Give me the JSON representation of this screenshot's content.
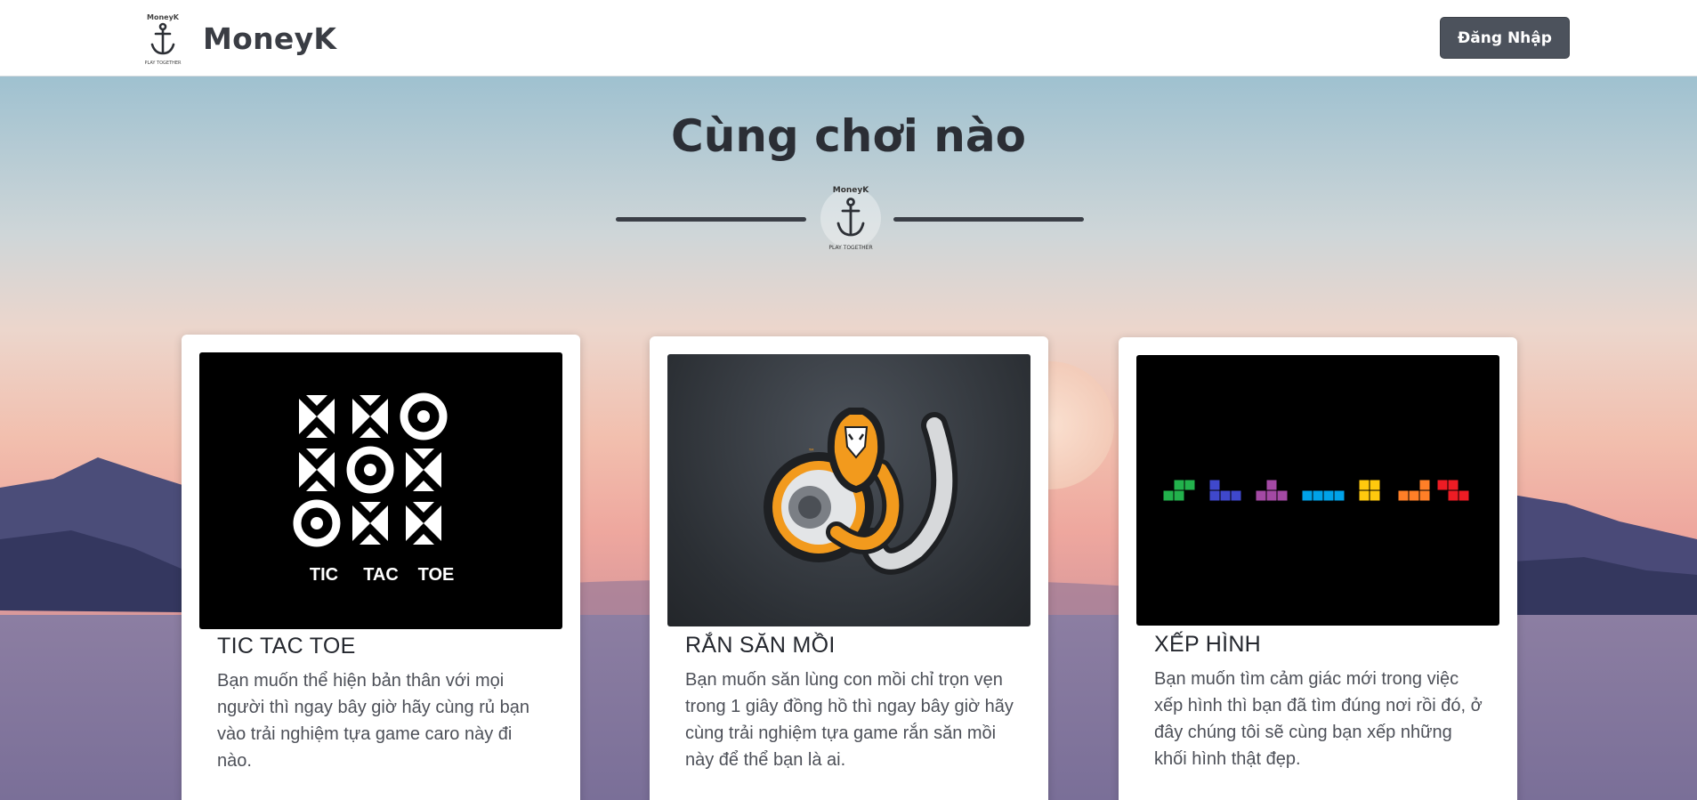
{
  "navbar": {
    "brand_name": "MoneyK",
    "logo_text_top": "MoneyK",
    "logo_text_bottom": "PLAY TOGETHER",
    "login_label": "Đăng Nhập"
  },
  "hero": {
    "title": "Cùng chơi nào",
    "emblem_text_top": "MoneyK",
    "emblem_text_bottom": "PLAY TOGETHER"
  },
  "games": [
    {
      "title": "TIC TAC TOE",
      "description": "Bạn muốn thể hiện bản thân với mọi người thì ngay bây giờ hãy cùng rủ bạn vào trải nghiệm tựa game caro này đi nào.",
      "image_words": [
        "TIC",
        "TAC",
        "TOE"
      ]
    },
    {
      "title": "RẮN SĂN MỒI",
      "description": "Bạn muốn săn lùng con mồi chỉ trọn vẹn trong 1 giây đồng hồ thì ngay bây giờ hãy cùng trải nghiệm tựa game rắn săn mồi này để thể bạn là ai.",
      "image_mark": "™"
    },
    {
      "title": "XẾP HÌNH",
      "description": "Bạn muốn tìm cảm giác mới trong việc xếp hình thì bạn đã tìm đúng nơi rồi đó, ở đây chúng tôi sẽ cùng bạn xếp những khối hình thật đẹp."
    }
  ],
  "colors": {
    "login_button": "#4c525c",
    "tetromino_colors": [
      "#22b14c",
      "#3f48cc",
      "#a349a4",
      "#00a2e8",
      "#ffc90e",
      "#ff7f27",
      "#ed1c24"
    ]
  }
}
